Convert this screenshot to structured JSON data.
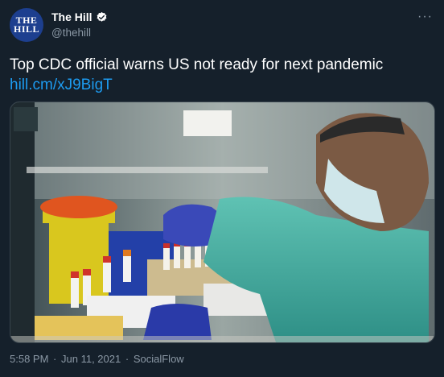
{
  "account": {
    "display_name": "The Hill",
    "handle": "@thehill",
    "avatar_text_top": "THE",
    "avatar_text_bottom": "HILL",
    "verified": true
  },
  "tweet": {
    "text": "Top CDC official warns US not ready for next pandemic",
    "link": "hill.cm/xJ9BigT"
  },
  "media": {
    "sign_text": "..."
  },
  "footer": {
    "time": "5:58 PM",
    "date": "Jun 11, 2021",
    "source": "SocialFlow",
    "separator": "·"
  },
  "icons": {
    "more": "more-options-icon",
    "verified": "verified-badge-icon"
  },
  "colors": {
    "background": "#15202b",
    "link": "#1d9bf0",
    "muted": "#8b98a5",
    "avatar": "#1d3f8f"
  }
}
